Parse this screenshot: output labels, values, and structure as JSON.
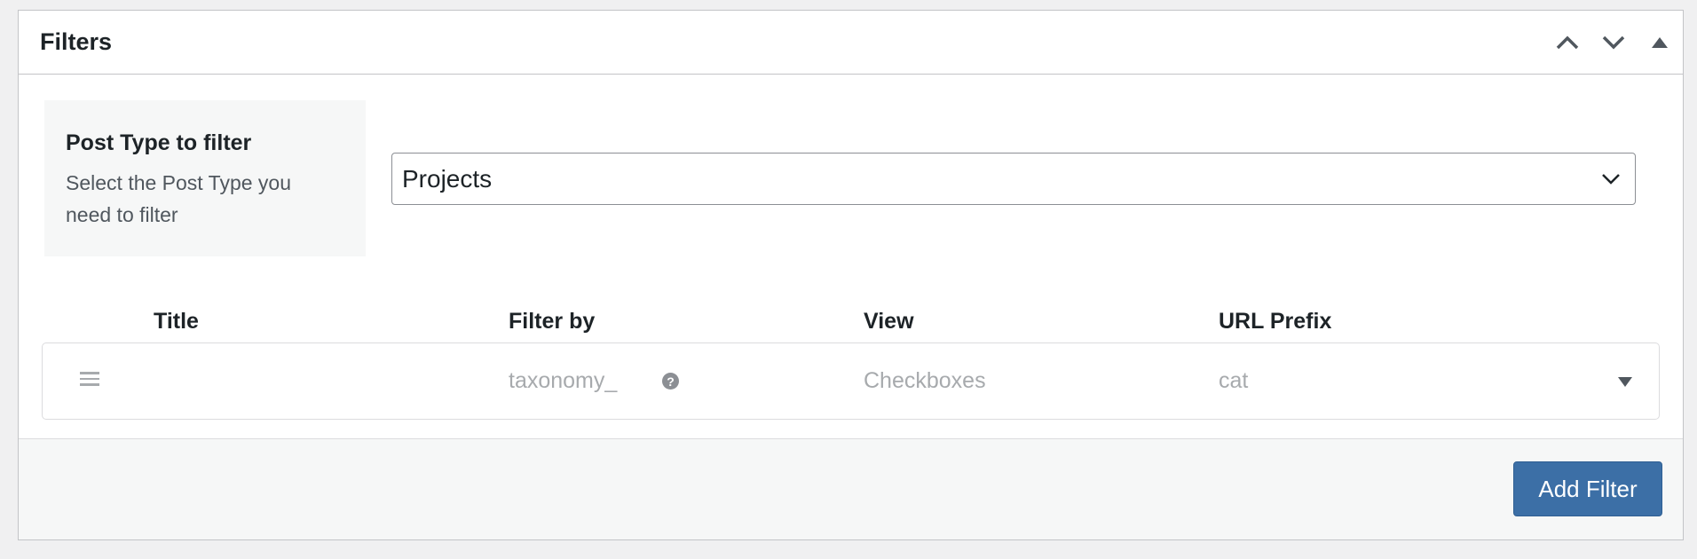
{
  "panel": {
    "title": "Filters",
    "controls": [
      "chevron-up-icon",
      "chevron-down-icon",
      "triangle-up-icon"
    ]
  },
  "post_type": {
    "label": "Post Type to filter",
    "description": "Select the Post Type you need to filter",
    "selected": "Projects"
  },
  "table": {
    "headers": {
      "title": "Title",
      "filter_by": "Filter by",
      "view": "View",
      "url_prefix": "URL Prefix"
    },
    "rows": [
      {
        "title": "",
        "filter_by": "taxonomy_",
        "view": "Checkboxes",
        "url_prefix": "cat"
      }
    ]
  },
  "footer": {
    "add_filter_label": "Add Filter"
  },
  "colors": {
    "accent": "#3c6fa6",
    "muted_text": "#a7aaad",
    "border": "#c3c4c7"
  }
}
